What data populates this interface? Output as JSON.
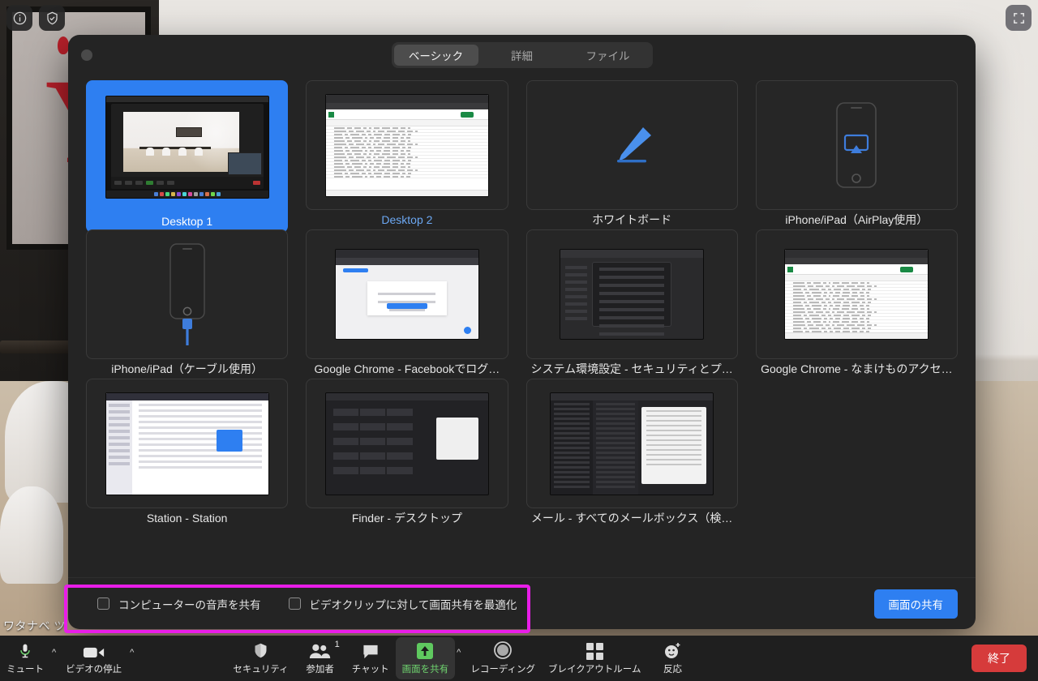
{
  "overlay": {
    "info_icon": "info-circle-icon",
    "security_icon": "shield-check-icon",
    "fullscreen_icon": "fullscreen-corners-icon",
    "participant_name": "ワタナベ ツ"
  },
  "dialog": {
    "close_button_label": "",
    "tabs": [
      {
        "label": "ベーシック",
        "active": true
      },
      {
        "label": "詳細",
        "active": false
      },
      {
        "label": "ファイル",
        "active": false
      }
    ],
    "items": [
      {
        "label": "Desktop 1",
        "kind": "desktop-zoom-meeting",
        "selected": true
      },
      {
        "label": "Desktop 2",
        "kind": "desktop-spreadsheet",
        "selected": false
      },
      {
        "label": "ホワイトボード",
        "kind": "whiteboard-icon",
        "selected": false
      },
      {
        "label": "iPhone/iPad（AirPlay使用）",
        "kind": "airplay-icon",
        "selected": false
      },
      {
        "label": "iPhone/iPad（ケーブル使用）",
        "kind": "cable-icon",
        "selected": false
      },
      {
        "label": "Google Chrome - Facebookでログ…",
        "kind": "window-chrome-facebook",
        "selected": false
      },
      {
        "label": "システム環境設定 - セキュリティとプ…",
        "kind": "window-system-prefs",
        "selected": false
      },
      {
        "label": "Google Chrome - なまけものアクセ…",
        "kind": "window-chrome-sheet",
        "selected": false
      },
      {
        "label": "Station - Station",
        "kind": "window-station",
        "selected": false
      },
      {
        "label": "Finder - デスクトップ",
        "kind": "window-finder",
        "selected": false
      },
      {
        "label": "メール - すべてのメールボックス（検…",
        "kind": "window-mail",
        "selected": false
      }
    ],
    "footer": {
      "options": [
        {
          "label": "コンピューターの音声を共有",
          "checked": false
        },
        {
          "label": "ビデオクリップに対して画面共有を最適化",
          "checked": false
        }
      ],
      "share_button": "画面の共有",
      "highlight_color": "#e81de8"
    }
  },
  "toolbar": {
    "mute": {
      "label": "ミュート",
      "icon": "microphone-icon",
      "caret": "^"
    },
    "video": {
      "label": "ビデオの停止",
      "icon": "camera-icon",
      "caret": "^"
    },
    "security": {
      "label": "セキュリティ",
      "icon": "shield-icon"
    },
    "participants": {
      "label": "参加者",
      "icon": "people-icon",
      "count": "1"
    },
    "chat": {
      "label": "チャット",
      "icon": "chat-bubble-icon"
    },
    "share": {
      "label": "画面を共有",
      "icon": "share-up-arrow-icon",
      "caret": "^",
      "active": true,
      "accent": "#5fc95f"
    },
    "record": {
      "label": "レコーディング",
      "icon": "record-circle-icon"
    },
    "breakout": {
      "label": "ブレイクアウトルーム",
      "icon": "four-squares-icon"
    },
    "reactions": {
      "label": "反応",
      "icon": "smiley-plus-icon"
    },
    "end": {
      "label": "終了",
      "color": "#d63b3b"
    }
  }
}
